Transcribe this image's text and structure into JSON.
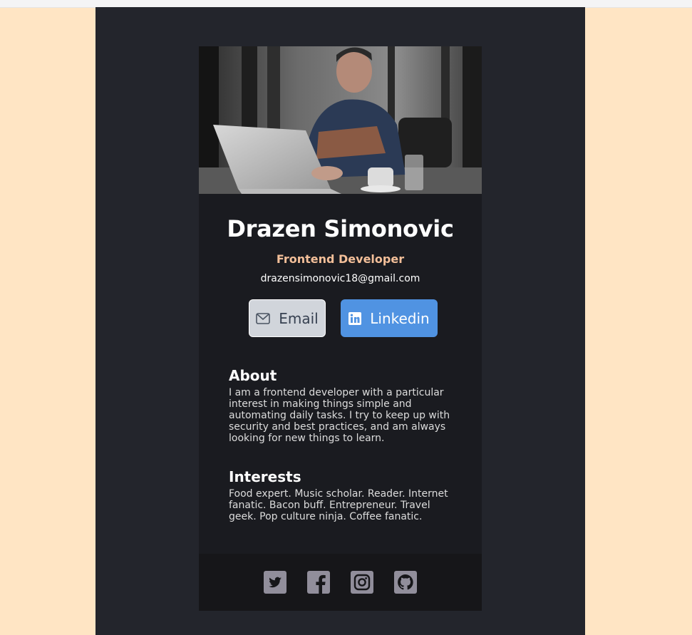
{
  "profile": {
    "name": "Drazen Simonovic",
    "role": "Frontend Developer",
    "email": "drazensimonovic18@gmail.com"
  },
  "buttons": {
    "email_label": "Email",
    "linkedin_label": "Linkedin"
  },
  "about": {
    "title": "About",
    "text": "I am a frontend developer with a particular interest in making things simple and automating daily tasks. I try to keep up with security and best practices, and am always looking for new things to learn."
  },
  "interests": {
    "title": "Interests",
    "text": "Food expert. Music scholar. Reader. Internet fanatic. Bacon buff. Entrepreneur. Travel geek. Pop culture ninja. Coffee fanatic."
  },
  "social": [
    "twitter-icon",
    "facebook-icon",
    "instagram-icon",
    "github-icon"
  ],
  "colors": {
    "background": "#ffe5c4",
    "page": "#23252c",
    "card": "#1a1b20",
    "footer": "#161619",
    "accent": "#f3bf99",
    "linkedin": "#5093e2",
    "email_button": "#d1d5db"
  }
}
